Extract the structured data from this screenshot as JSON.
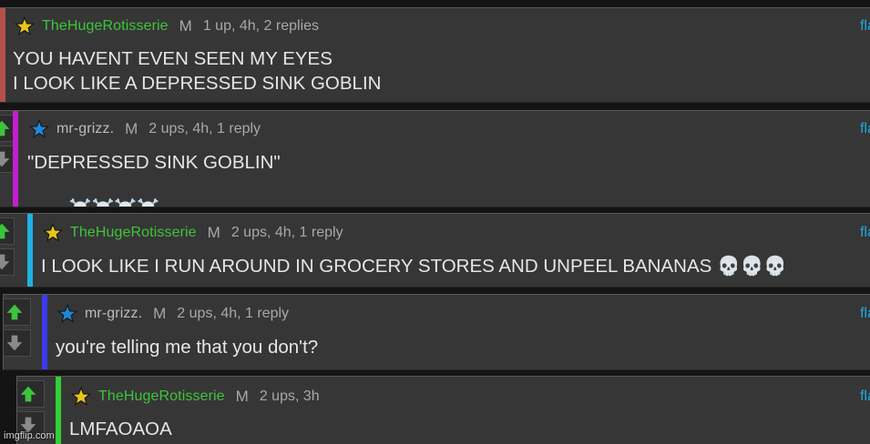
{
  "comments": [
    {
      "username": "TheHugeRotisserie",
      "badge": "M",
      "meta": "1 up, 4h, 2 replies",
      "flag": "fla",
      "line1": "YOU HAVENT EVEN SEEN MY EYES",
      "line2": "I LOOK LIKE A DEPRESSED SINK GOBLIN",
      "bar_color": "#b3504c",
      "user_color": "#3fc43a",
      "star": "star-yellow-icon"
    },
    {
      "username": "mr-grizz.",
      "badge": "M",
      "meta": "2 ups, 4h, 1 reply",
      "flag": "fla",
      "line1": "\"DEPRESSED SINK GOBLIN\"",
      "line2": "☠️☠️☠️☠️",
      "bar_color": "#c21fcf",
      "user_color": "#bdbdbd",
      "star": "star-blue-icon"
    },
    {
      "username": "TheHugeRotisserie",
      "badge": "M",
      "meta": "2 ups, 4h, 1 reply",
      "flag": "fla",
      "line1": "I LOOK LIKE I RUN AROUND IN GROCERY STORES AND UNPEEL BANANAS 💀💀💀",
      "bar_color": "#1fb2e6",
      "user_color": "#3fc43a",
      "star": "star-yellow-icon"
    },
    {
      "username": "mr-grizz.",
      "badge": "M",
      "meta": "2 ups, 4h, 1 reply",
      "flag": "fla",
      "line1": "you're telling me that you don't?",
      "bar_color": "#3b3bf0",
      "user_color": "#bdbdbd",
      "star": "star-blue-icon"
    },
    {
      "username": "TheHugeRotisserie",
      "badge": "M",
      "meta": "2 ups, 3h",
      "flag": "fla",
      "line1": "LMFAOAOA",
      "bar_color": "#31d134",
      "user_color": "#3fc43a",
      "star": "star-yellow-icon"
    }
  ],
  "watermark": "imgflip.com"
}
